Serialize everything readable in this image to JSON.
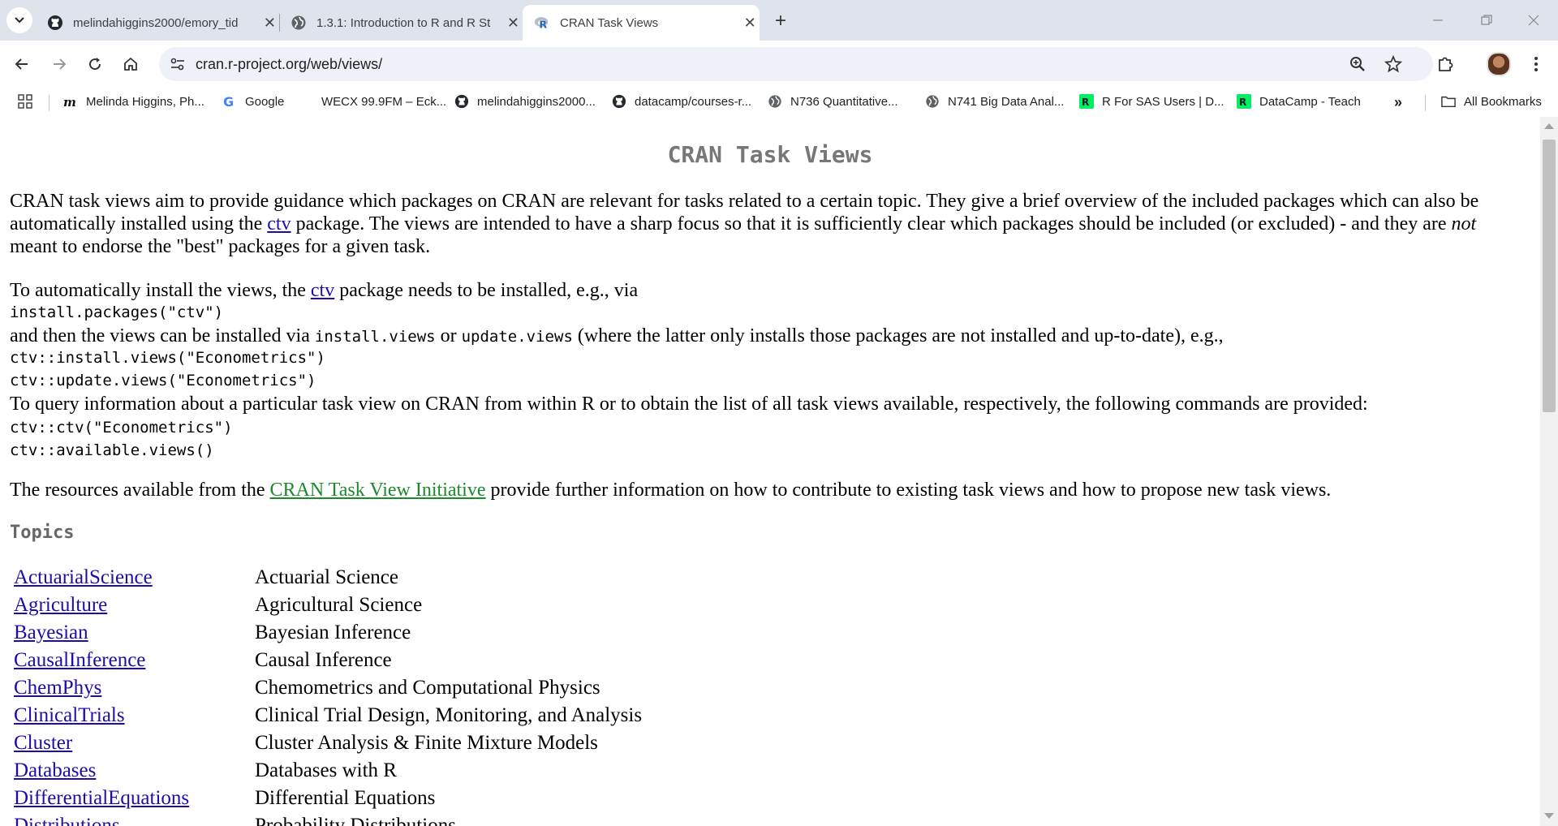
{
  "tabs": [
    {
      "title": "melindahiggins2000/emory_tid",
      "icon": "github-icon"
    },
    {
      "title": "1.3.1: Introduction to R and R St",
      "icon": "globe-icon"
    },
    {
      "title": "CRAN Task Views",
      "icon": "r-logo-icon"
    }
  ],
  "toolbar": {
    "url": "cran.r-project.org/web/views/"
  },
  "bookmarks": [
    {
      "label": "Melinda Higgins, Ph...",
      "icon": "mh-logo-icon"
    },
    {
      "label": "Google",
      "icon": "google-icon"
    },
    {
      "label": "WECX 99.9FM – Eck...",
      "icon": "blank-icon"
    },
    {
      "label": "melindahiggins2000...",
      "icon": "github-icon"
    },
    {
      "label": "datacamp/courses-r...",
      "icon": "github-icon"
    },
    {
      "label": "N736 Quantitative...",
      "icon": "globe-icon"
    },
    {
      "label": "N741 Big Data Anal...",
      "icon": "globe-icon"
    },
    {
      "label": "R For SAS Users | D...",
      "icon": "datacamp-icon"
    },
    {
      "label": "DataCamp - Teach",
      "icon": "datacamp-icon"
    }
  ],
  "bookmarks_all": "All Bookmarks",
  "page": {
    "title": "CRAN Task Views",
    "intro_a": "CRAN task views aim to provide guidance which packages on CRAN are relevant for tasks related to a certain topic. They give a brief overview of the included packages which can also be automatically installed using the ",
    "intro_link": "ctv",
    "intro_b": " package. The views are intended to have a sharp focus so that it is sufficiently clear which packages should be included (or excluded) - and they are ",
    "intro_em": "not",
    "intro_c": " meant to endorse the \"best\" packages for a given task.",
    "install_a": "To automatically install the views, the ",
    "install_link": "ctv",
    "install_b": " package needs to be installed, e.g., via",
    "code1": "install.packages(\"ctv\")",
    "then_a": "and then the views can be installed via ",
    "then_code1": "install.views",
    "then_b": " or ",
    "then_code2": "update.views",
    "then_c": " (where the latter only installs those packages are not installed and up-to-date), e.g.,",
    "code2": "ctv::install.views(\"Econometrics\")",
    "code3": "ctv::update.views(\"Econometrics\")",
    "query": "To query information about a particular task view on CRAN from within R or to obtain the list of all task views available, respectively, the following commands are provided:",
    "code4": "ctv::ctv(\"Econometrics\")",
    "code5": "ctv::available.views()",
    "resources_a": "The resources available from the ",
    "resources_link": "CRAN Task View Initiative",
    "resources_b": " provide further information on how to contribute to existing task views and how to propose new task views.",
    "topics_heading": "Topics",
    "topics": [
      {
        "name": "ActuarialScience",
        "desc": "Actuarial Science"
      },
      {
        "name": "Agriculture",
        "desc": "Agricultural Science"
      },
      {
        "name": "Bayesian",
        "desc": "Bayesian Inference"
      },
      {
        "name": "CausalInference",
        "desc": "Causal Inference"
      },
      {
        "name": "ChemPhys",
        "desc": "Chemometrics and Computational Physics"
      },
      {
        "name": "ClinicalTrials",
        "desc": "Clinical Trial Design, Monitoring, and Analysis"
      },
      {
        "name": "Cluster",
        "desc": "Cluster Analysis & Finite Mixture Models"
      },
      {
        "name": "Databases",
        "desc": "Databases with R"
      },
      {
        "name": "DifferentialEquations",
        "desc": "Differential Equations"
      },
      {
        "name": "Distributions",
        "desc": "Probability Distributions"
      }
    ]
  }
}
